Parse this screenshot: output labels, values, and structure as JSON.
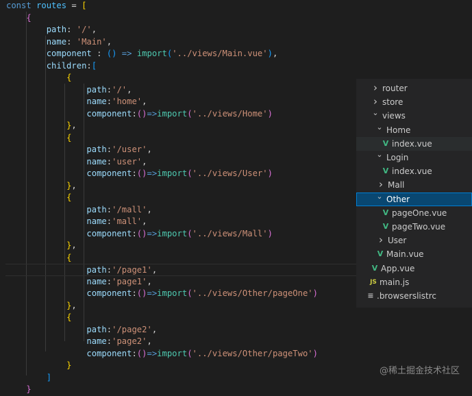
{
  "code": {
    "lines": [
      [
        [
          "kw",
          "const "
        ],
        [
          "var",
          "routes"
        ],
        [
          "pun",
          " = "
        ],
        [
          "br1",
          "["
        ]
      ],
      [
        [
          "pun",
          "    "
        ],
        [
          "br2",
          "{"
        ]
      ],
      [
        [
          "pun",
          "        "
        ],
        [
          "prop",
          "path"
        ],
        [
          "pun",
          ": "
        ],
        [
          "str",
          "'/'"
        ],
        [
          "pun",
          ","
        ]
      ],
      [
        [
          "pun",
          "        "
        ],
        [
          "prop",
          "name"
        ],
        [
          "pun",
          ": "
        ],
        [
          "str",
          "'Main'"
        ],
        [
          "pun",
          ","
        ]
      ],
      [
        [
          "pun",
          "        "
        ],
        [
          "prop",
          "component"
        ],
        [
          "pun",
          " : "
        ],
        [
          "br3",
          "()"
        ],
        [
          "kw",
          " => "
        ],
        [
          "fn",
          "import"
        ],
        [
          "br3",
          "("
        ],
        [
          "str",
          "'../views/Main.vue'"
        ],
        [
          "br3",
          ")"
        ],
        [
          "pun",
          ","
        ]
      ],
      [
        [
          "pun",
          "        "
        ],
        [
          "prop",
          "children"
        ],
        [
          "pun",
          ":"
        ],
        [
          "br3",
          "["
        ]
      ],
      [
        [
          "pun",
          "            "
        ],
        [
          "br1",
          "{"
        ]
      ],
      [
        [
          "pun",
          "                "
        ],
        [
          "prop",
          "path"
        ],
        [
          "pun",
          ":"
        ],
        [
          "str",
          "'/'"
        ],
        [
          "pun",
          ","
        ]
      ],
      [
        [
          "pun",
          "                "
        ],
        [
          "prop",
          "name"
        ],
        [
          "pun",
          ":"
        ],
        [
          "str",
          "'home'"
        ],
        [
          "pun",
          ","
        ]
      ],
      [
        [
          "pun",
          "                "
        ],
        [
          "prop",
          "component"
        ],
        [
          "pun",
          ":"
        ],
        [
          "br2",
          "()"
        ],
        [
          "kw",
          "=>"
        ],
        [
          "fn",
          "import"
        ],
        [
          "br2",
          "("
        ],
        [
          "str",
          "'../views/Home'"
        ],
        [
          "br2",
          ")"
        ]
      ],
      [
        [
          "pun",
          "            "
        ],
        [
          "br1",
          "}"
        ],
        [
          "pun",
          ","
        ]
      ],
      [
        [
          "pun",
          "            "
        ],
        [
          "br1",
          "{"
        ]
      ],
      [
        [
          "pun",
          "                "
        ],
        [
          "prop",
          "path"
        ],
        [
          "pun",
          ":"
        ],
        [
          "str",
          "'/user'"
        ],
        [
          "pun",
          ","
        ]
      ],
      [
        [
          "pun",
          "                "
        ],
        [
          "prop",
          "name"
        ],
        [
          "pun",
          ":"
        ],
        [
          "str",
          "'user'"
        ],
        [
          "pun",
          ","
        ]
      ],
      [
        [
          "pun",
          "                "
        ],
        [
          "prop",
          "component"
        ],
        [
          "pun",
          ":"
        ],
        [
          "br2",
          "()"
        ],
        [
          "kw",
          "=>"
        ],
        [
          "fn",
          "import"
        ],
        [
          "br2",
          "("
        ],
        [
          "str",
          "'../views/User'"
        ],
        [
          "br2",
          ")"
        ]
      ],
      [
        [
          "pun",
          "            "
        ],
        [
          "br1",
          "}"
        ],
        [
          "pun",
          ","
        ]
      ],
      [
        [
          "pun",
          "            "
        ],
        [
          "br1",
          "{"
        ]
      ],
      [
        [
          "pun",
          "                "
        ],
        [
          "prop",
          "path"
        ],
        [
          "pun",
          ":"
        ],
        [
          "str",
          "'/mall'"
        ],
        [
          "pun",
          ","
        ]
      ],
      [
        [
          "pun",
          "                "
        ],
        [
          "prop",
          "name"
        ],
        [
          "pun",
          ":"
        ],
        [
          "str",
          "'mall'"
        ],
        [
          "pun",
          ","
        ]
      ],
      [
        [
          "pun",
          "                "
        ],
        [
          "prop",
          "component"
        ],
        [
          "pun",
          ":"
        ],
        [
          "br2",
          "()"
        ],
        [
          "kw",
          "=>"
        ],
        [
          "fn",
          "import"
        ],
        [
          "br2",
          "("
        ],
        [
          "str",
          "'../views/Mall'"
        ],
        [
          "br2",
          ")"
        ]
      ],
      [
        [
          "pun",
          "            "
        ],
        [
          "br1",
          "}"
        ],
        [
          "pun",
          ","
        ]
      ],
      [
        [
          "pun",
          "            "
        ],
        [
          "br1",
          "{"
        ]
      ],
      [
        [
          "pun",
          "                "
        ],
        [
          "prop",
          "path"
        ],
        [
          "pun",
          ":"
        ],
        [
          "str",
          "'/page1'"
        ],
        [
          "pun",
          ","
        ]
      ],
      [
        [
          "pun",
          "                "
        ],
        [
          "prop",
          "name"
        ],
        [
          "pun",
          ":"
        ],
        [
          "str",
          "'page1'"
        ],
        [
          "pun",
          ","
        ]
      ],
      [
        [
          "pun",
          "                "
        ],
        [
          "prop",
          "component"
        ],
        [
          "pun",
          ":"
        ],
        [
          "br2",
          "()"
        ],
        [
          "kw",
          "=>"
        ],
        [
          "fn",
          "import"
        ],
        [
          "br2",
          "("
        ],
        [
          "str",
          "'../views/Other/pageOne'"
        ],
        [
          "br2",
          ")"
        ]
      ],
      [
        [
          "pun",
          "            "
        ],
        [
          "br1",
          "}"
        ],
        [
          "pun",
          ","
        ]
      ],
      [
        [
          "pun",
          "            "
        ],
        [
          "br1",
          "{"
        ]
      ],
      [
        [
          "pun",
          "                "
        ],
        [
          "prop",
          "path"
        ],
        [
          "pun",
          ":"
        ],
        [
          "str",
          "'/page2'"
        ],
        [
          "pun",
          ","
        ]
      ],
      [
        [
          "pun",
          "                "
        ],
        [
          "prop",
          "name"
        ],
        [
          "pun",
          ":"
        ],
        [
          "str",
          "'page2'"
        ],
        [
          "pun",
          ","
        ]
      ],
      [
        [
          "pun",
          "                "
        ],
        [
          "prop",
          "component"
        ],
        [
          "pun",
          ":"
        ],
        [
          "br2",
          "()"
        ],
        [
          "kw",
          "=>"
        ],
        [
          "fn",
          "import"
        ],
        [
          "br2",
          "("
        ],
        [
          "str",
          "'../views/Other/pageTwo'"
        ],
        [
          "br2",
          ")"
        ]
      ],
      [
        [
          "pun",
          "            "
        ],
        [
          "br1",
          "}"
        ]
      ],
      [
        [
          "pun",
          "        "
        ],
        [
          "br3",
          "]"
        ]
      ],
      [
        [
          "pun",
          "    "
        ],
        [
          "br2",
          "}"
        ]
      ]
    ]
  },
  "explorer": {
    "items": [
      {
        "label": "router",
        "icon": "chevron-right-icon",
        "glyph": "›"
      },
      {
        "label": "store",
        "icon": "chevron-right-icon",
        "glyph": "›"
      },
      {
        "label": "views",
        "icon": "chevron-down-icon",
        "glyph": "⌄"
      },
      {
        "label": "Home",
        "icon": "chevron-down-icon",
        "glyph": "⌄"
      },
      {
        "label": "index.vue",
        "icon": "vue-file-icon",
        "glyph": "V"
      },
      {
        "label": "Login",
        "icon": "chevron-down-icon",
        "glyph": "⌄"
      },
      {
        "label": "index.vue",
        "icon": "vue-file-icon",
        "glyph": "V"
      },
      {
        "label": "Mall",
        "icon": "chevron-right-icon",
        "glyph": "›"
      },
      {
        "label": "Other",
        "icon": "chevron-down-icon",
        "glyph": "⌄"
      },
      {
        "label": "pageOne.vue",
        "icon": "vue-file-icon",
        "glyph": "V"
      },
      {
        "label": "pageTwo.vue",
        "icon": "vue-file-icon",
        "glyph": "V"
      },
      {
        "label": "User",
        "icon": "chevron-right-icon",
        "glyph": "›"
      },
      {
        "label": "Main.vue",
        "icon": "vue-file-icon",
        "glyph": "V"
      },
      {
        "label": "App.vue",
        "icon": "vue-file-icon",
        "glyph": "V"
      },
      {
        "label": "main.js",
        "icon": "js-file-icon",
        "glyph": "JS"
      },
      {
        "label": ".browserslistrc",
        "icon": "config-file-icon",
        "glyph": "≡"
      }
    ]
  },
  "watermark": "@稀土掘金技术社区",
  "colors": {
    "background": "#1e1e1e",
    "explorer_background": "#252526",
    "selected_row": "#094771",
    "vue_green": "#41b883"
  }
}
